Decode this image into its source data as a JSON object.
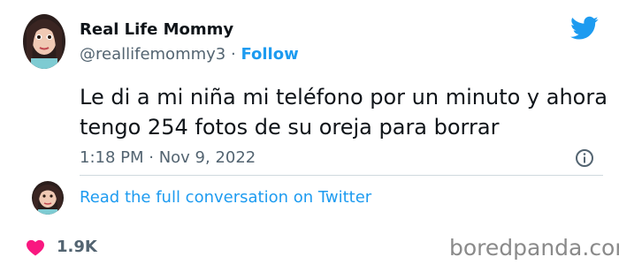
{
  "tweet": {
    "author_name": "Real Life Mommy",
    "handle": "@reallifemommy3",
    "separator": "·",
    "follow_label": "Follow",
    "text": "Le di a mi niña mi teléfono por un minuto y ahora tengo 254 fotos de su oreja para borrar",
    "timestamp": "1:18 PM · Nov 9, 2022",
    "read_more_label": "Read the full conversation on Twitter",
    "likes": "1.9K"
  },
  "icons": {
    "brand": "twitter-bird-icon",
    "info": "info-icon",
    "like": "heart-icon"
  },
  "watermark": "boredpanda.com",
  "colors": {
    "accent": "#1d9bf0",
    "text": "#0f1419",
    "muted": "#536471",
    "heart": "#f91880",
    "divider": "#cfd9de"
  }
}
